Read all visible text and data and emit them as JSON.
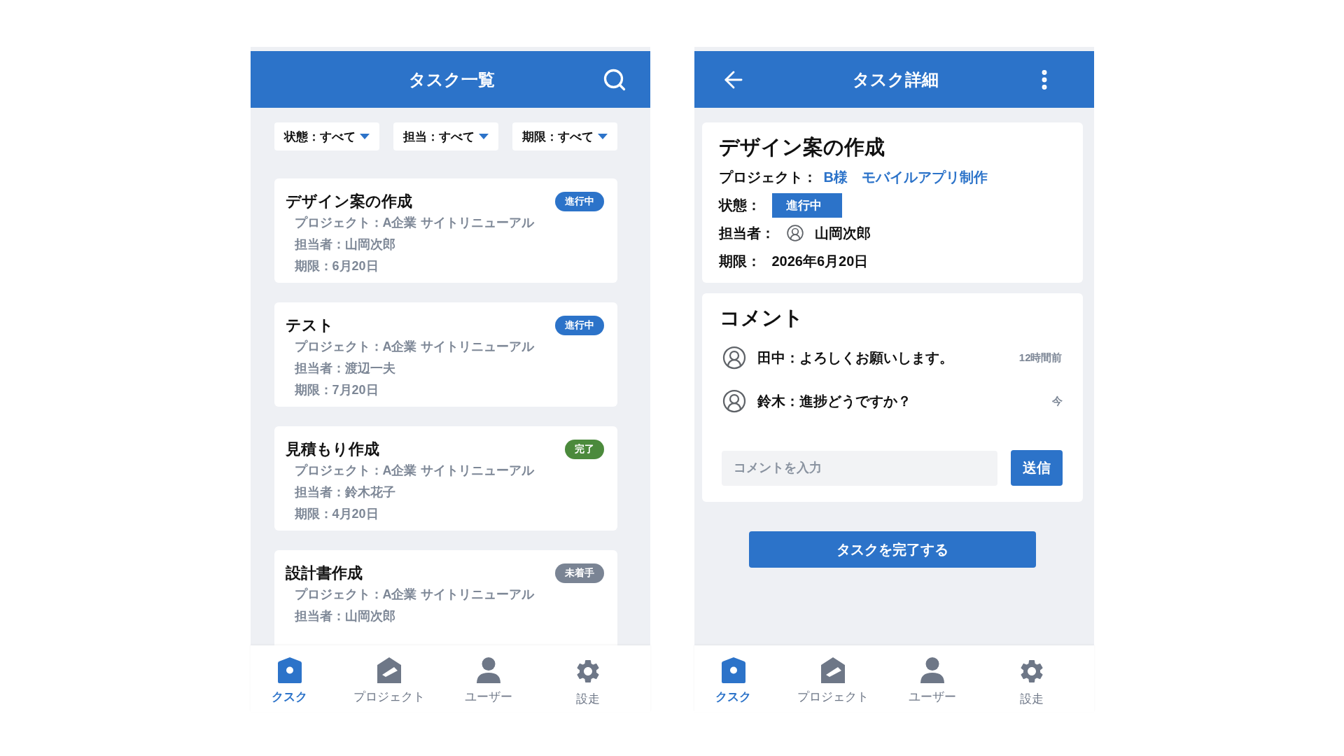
{
  "task_list_screen": {
    "header": {
      "title": "タスク一覧"
    },
    "filters": [
      {
        "label": "状態：すべて"
      },
      {
        "label": "担当：すべて"
      },
      {
        "label": "期限：すべて"
      }
    ],
    "tasks": [
      {
        "title": "デザイン案の作成",
        "badge": {
          "label": "進行中",
          "color": "#2c73c9"
        },
        "details": [
          "プロジェクト：A企業 サイトリニューアル",
          "担当者：山岡次郎",
          "期限：6月20日"
        ]
      },
      {
        "title": "テスト",
        "badge": {
          "label": "進行中",
          "color": "#2c73c9"
        },
        "details": [
          "プロジェクト：A企業 サイトリニューアル",
          "担当者：渡辺一夫",
          "期限：7月20日"
        ]
      },
      {
        "title": "見積もり作成",
        "badge": {
          "label": "完了",
          "color": "#4b8a3c"
        },
        "details": [
          "プロジェクト：A企業 サイトリニューアル",
          "担当者：鈴木花子",
          "期限：4月20日"
        ]
      },
      {
        "title": "設計書作成",
        "badge": {
          "label": "未着手",
          "color": "#7a8494"
        },
        "details": [
          "プロジェクト：A企業 サイトリニューアル",
          "担当者：山岡次郎"
        ]
      }
    ],
    "nav": [
      {
        "label": "クスク",
        "selected": true
      },
      {
        "label": "プロジェクト",
        "selected": false
      },
      {
        "label": "ユーザー",
        "selected": false
      },
      {
        "label": "設走",
        "selected": false
      }
    ]
  },
  "task_detail_screen": {
    "header": {
      "title": "タスク詳細"
    },
    "task": {
      "title": "デザイン案の作成",
      "project": {
        "label": "プロジェクト：",
        "value": "B様　モバイルアプリ制作"
      },
      "status": {
        "label": "状態：",
        "value": "進行中"
      },
      "assignee": {
        "label": "担当者：",
        "value": "山岡次郎"
      },
      "deadline": {
        "label": "期限：",
        "value": "2026年6月20日"
      }
    },
    "comments": {
      "title": "コメント",
      "items": [
        {
          "text": "田中：よろしくお願いします。",
          "time": "12時間前"
        },
        {
          "text": "鈴木：進捗どうですか？",
          "time": "今"
        }
      ],
      "input": {
        "placeholder": "コメントを入力"
      },
      "send_button": "送信"
    },
    "complete_button": "タスクを完了する",
    "nav": [
      {
        "label": "クスク",
        "selected": true
      },
      {
        "label": "プロジェクト",
        "selected": false
      },
      {
        "label": "ユーザー",
        "selected": false
      },
      {
        "label": "設走",
        "selected": false
      }
    ]
  }
}
